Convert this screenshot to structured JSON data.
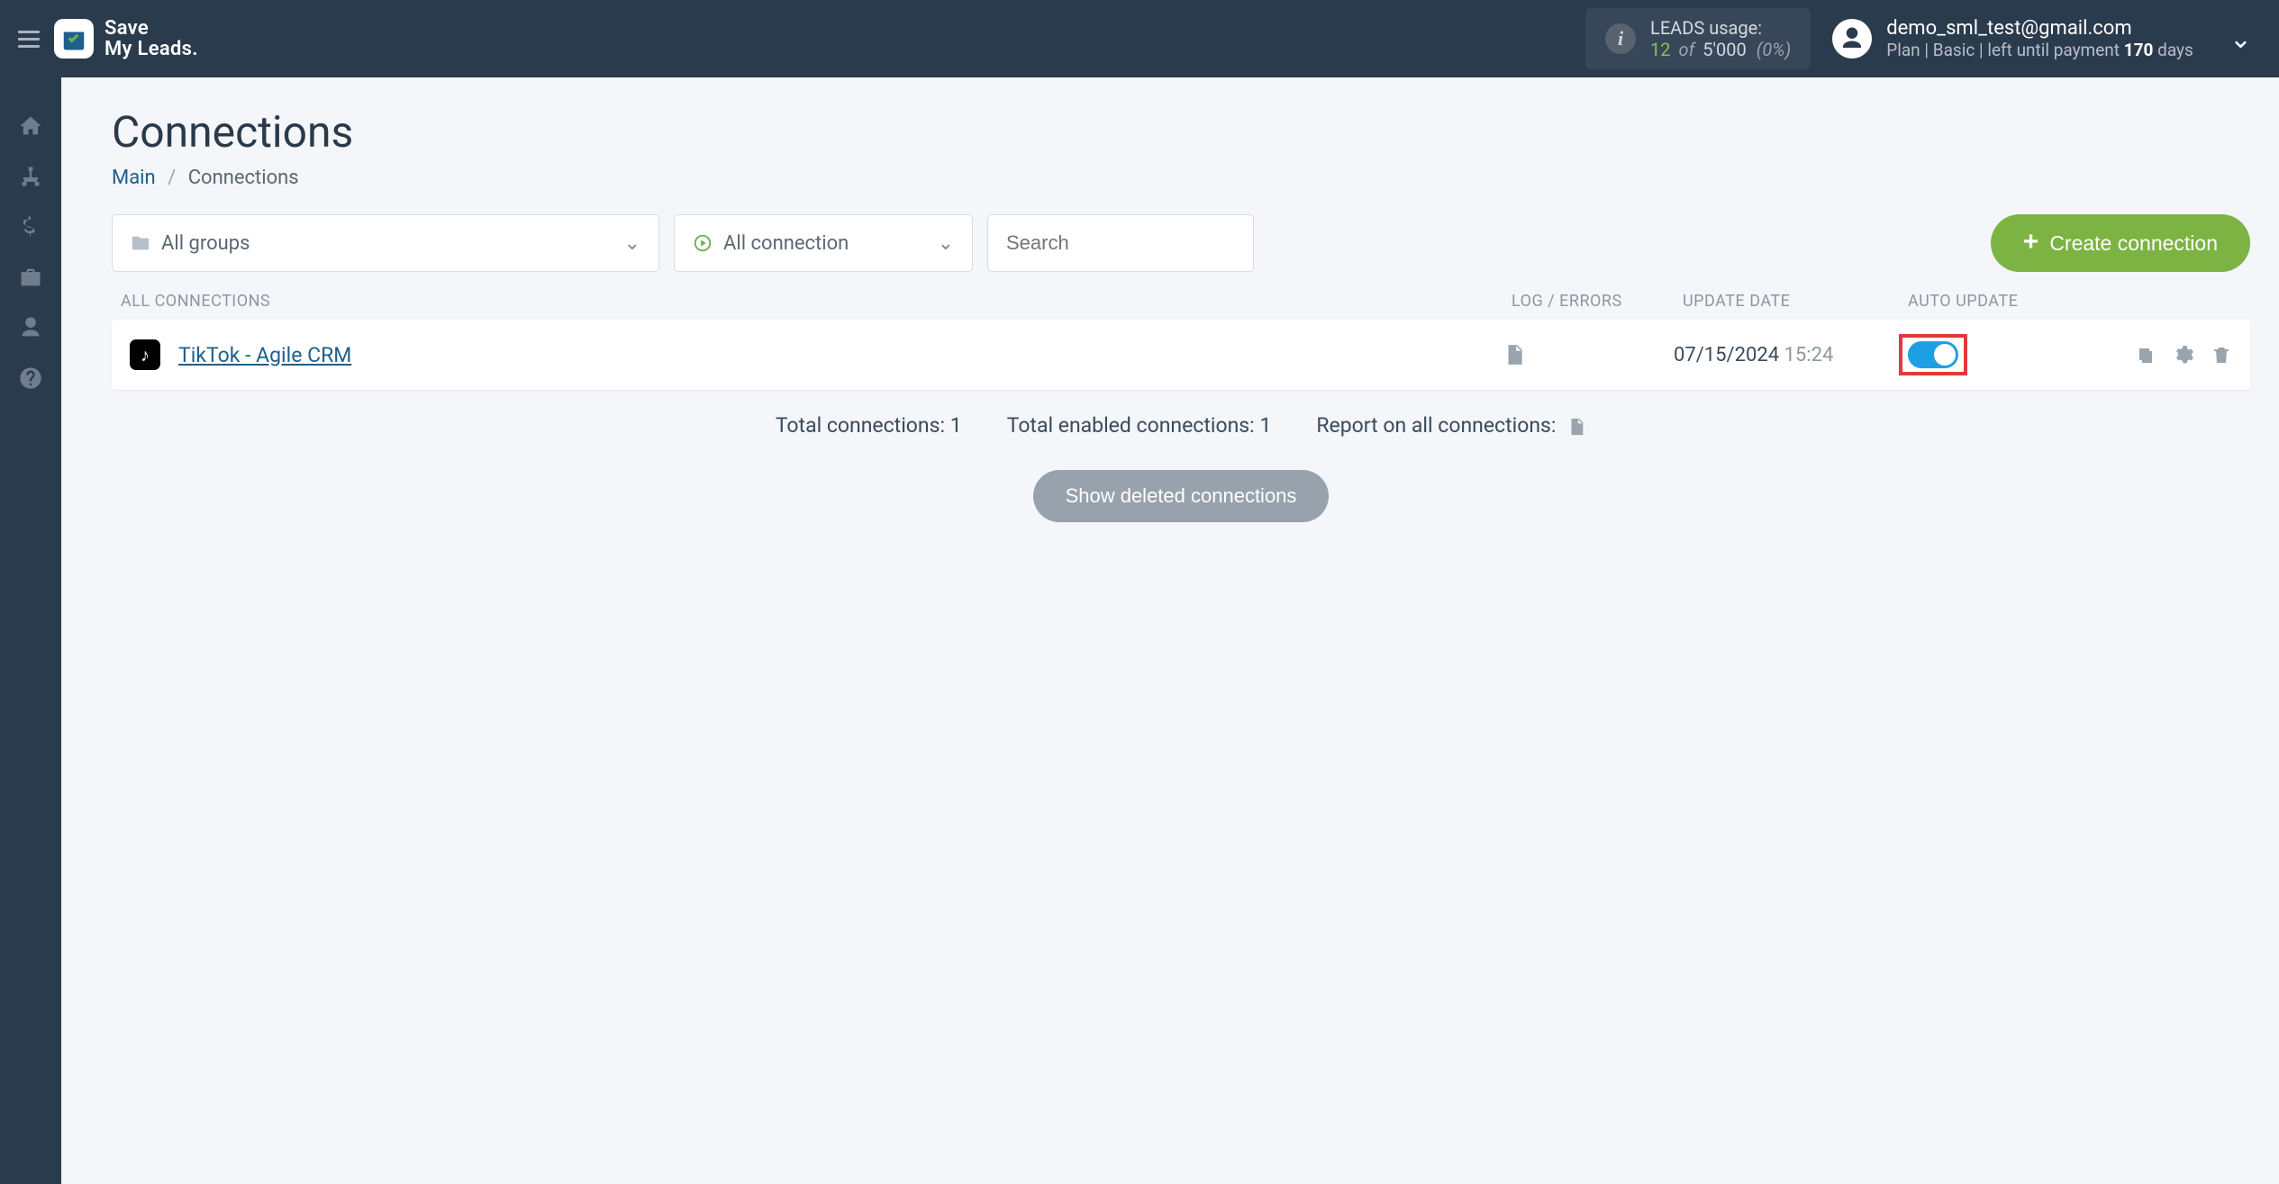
{
  "brand": {
    "line1": "Save",
    "line2": "My Leads."
  },
  "header": {
    "leads_usage_label": "LEADS usage:",
    "leads_used": "12",
    "leads_of": "of",
    "leads_limit": "5'000",
    "leads_pct": "(0%)",
    "account_email": "demo_sml_test@gmail.com",
    "plan_prefix": "Plan | Basic |  left until payment ",
    "plan_days": "170",
    "plan_suffix": " days"
  },
  "page": {
    "title": "Connections",
    "breadcrumb_main": "Main",
    "breadcrumb_here": "Connections"
  },
  "filters": {
    "group_label": "All groups",
    "status_label": "All connection",
    "search_placeholder": "Search",
    "create_label": "Create connection"
  },
  "table": {
    "col_all": "ALL CONNECTIONS",
    "col_log": "LOG / ERRORS",
    "col_date": "UPDATE DATE",
    "col_auto": "AUTO UPDATE"
  },
  "connections": [
    {
      "name": "TikTok - Agile CRM",
      "source_icon_label": "♪",
      "update_date": "07/15/2024",
      "update_time": "15:24",
      "auto_update_on": true
    }
  ],
  "summary": {
    "total_connections_label": "Total connections: ",
    "total_connections_value": "1",
    "total_enabled_label": "Total enabled connections: ",
    "total_enabled_value": "1",
    "report_label": "Report on all connections:"
  },
  "show_deleted_label": "Show deleted connections"
}
